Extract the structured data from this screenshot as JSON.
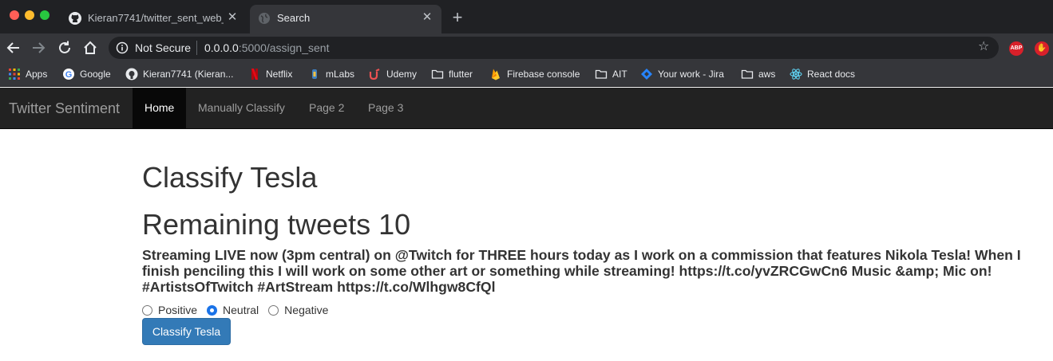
{
  "browser": {
    "tabs": [
      {
        "title": "Kieran7741/twitter_sent_web_app",
        "favicon": "github-icon",
        "active": false
      },
      {
        "title": "Search",
        "favicon": "globe-icon",
        "active": true
      }
    ],
    "address": {
      "security_label": "Not Secure",
      "host": "0.0.0.0",
      "path": ":5000/assign_sent"
    },
    "bookmarks": [
      {
        "label": "Apps",
        "icon": "apps-grid-icon"
      },
      {
        "label": "Google",
        "icon": "google-icon"
      },
      {
        "label": "Kieran7741 (Kieran...",
        "icon": "github-icon"
      },
      {
        "label": "Netflix",
        "icon": "netflix-icon"
      },
      {
        "label": "mLabs",
        "icon": "mlabs-icon"
      },
      {
        "label": "Udemy",
        "icon": "udemy-icon"
      },
      {
        "label": "flutter",
        "icon": "folder-icon"
      },
      {
        "label": "Firebase console",
        "icon": "firebase-icon"
      },
      {
        "label": "AIT",
        "icon": "folder-icon"
      },
      {
        "label": "Your work - Jira",
        "icon": "jira-icon"
      },
      {
        "label": "aws",
        "icon": "folder-icon"
      },
      {
        "label": "React docs",
        "icon": "react-icon"
      }
    ]
  },
  "navbar": {
    "brand": "Twitter Sentiment",
    "items": [
      {
        "label": "Home",
        "active": true
      },
      {
        "label": "Manually Classify",
        "active": false
      },
      {
        "label": "Page 2",
        "active": false
      },
      {
        "label": "Page 3",
        "active": false
      }
    ]
  },
  "main": {
    "heading": "Classify Tesla",
    "remaining": "Remaining tweets 10",
    "tweet": "Streaming LIVE now (3pm central) on @Twitch for THREE hours today as I work on a commission that features Nikola Tesla! When I finish penciling this I will work on some other art or something while streaming! https://t.co/yvZRCGwCn6 Music &amp; Mic on! #ArtistsOfTwitch #ArtStream https://t.co/Wlhgw8CfQl",
    "options": [
      {
        "label": "Positive",
        "checked": false
      },
      {
        "label": "Neutral",
        "checked": true
      },
      {
        "label": "Negative",
        "checked": false
      }
    ],
    "submit_label": "Classify Tesla"
  },
  "colors": {
    "navbar_bg": "#222222",
    "button_primary": "#337ab7",
    "radio_checked": "#1a73e8"
  }
}
